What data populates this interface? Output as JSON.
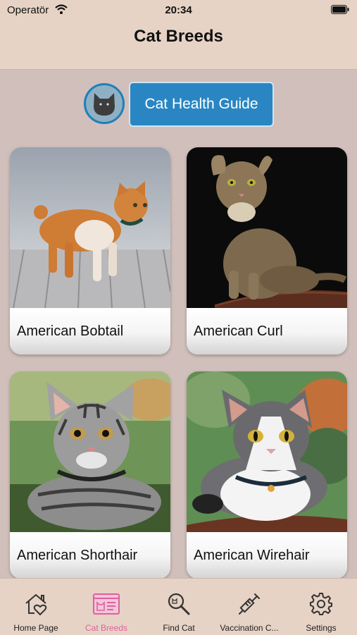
{
  "status_bar": {
    "carrier": "Operatör",
    "time": "20:34"
  },
  "nav": {
    "title": "Cat Breeds"
  },
  "guide": {
    "button_label": "Cat Health Guide"
  },
  "breeds": [
    {
      "name": "American Bobtail"
    },
    {
      "name": "American Curl"
    },
    {
      "name": "American Shorthair"
    },
    {
      "name": "American Wirehair"
    }
  ],
  "tabbar": {
    "active_color": "#e0609f",
    "tabs": [
      {
        "label": "Home Page",
        "icon": "house-heart-icon"
      },
      {
        "label": "Cat Breeds",
        "icon": "cat-id-card-icon",
        "active": true
      },
      {
        "label": "Find Cat",
        "icon": "magnifier-icon"
      },
      {
        "label": "Vaccination C...",
        "icon": "syringe-icon"
      },
      {
        "label": "Settings",
        "icon": "gear-icon"
      }
    ]
  }
}
